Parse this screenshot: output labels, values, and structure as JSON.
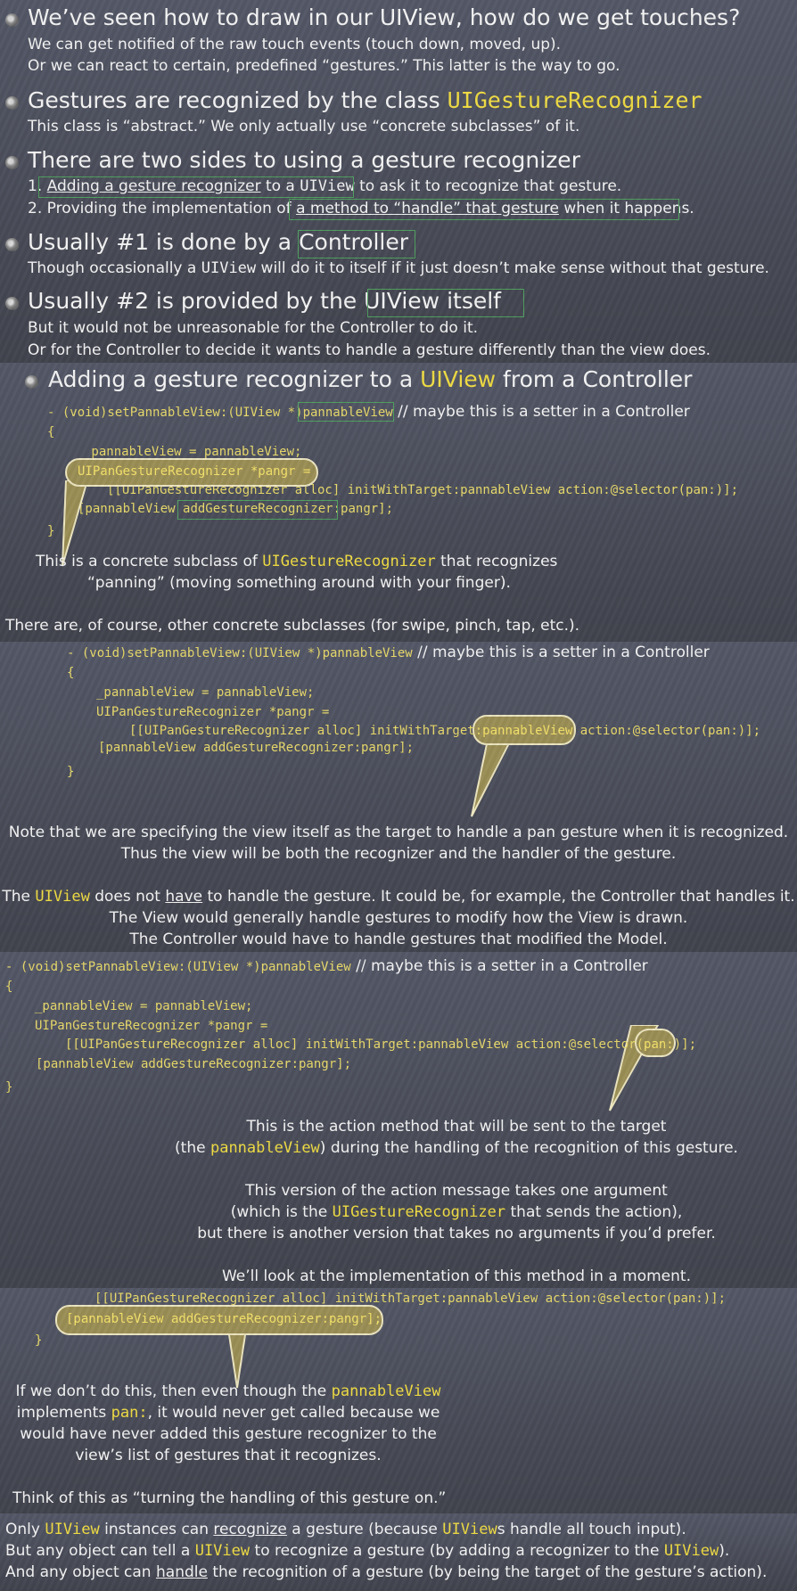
{
  "s1": {
    "b1": {
      "title": "We’ve seen how to draw in our UIView, how do we get touches?",
      "l1": "We can get notified of the raw touch events (touch down, moved, up).",
      "l2": "Or we can react to certain, predefined “gestures.”  This latter is the way to go."
    },
    "b2": {
      "t1": "Gestures are recognized by the class ",
      "t2": "UIGestureRecognizer",
      "l1": "This class is “abstract.”  We only actually use “concrete subclasses” of it."
    },
    "b3": {
      "title": "There are two sides to using a gesture recognizer",
      "l1a": "1. ",
      "l1b": "Adding a gesture recognizer",
      "l1c": " to a ",
      "l1d": "UIView",
      "l1e": " to ask it to recognize that gesture.",
      "l2a": "2. Providing the implementation of ",
      "l2b": "a method to “handle” that gesture",
      "l2c": " when it happens."
    },
    "b4": {
      "t1": "Usually #1 is done by a ",
      "t2": "Controller",
      "l1a": "Though occasionally a ",
      "l1b": "UIView",
      "l1c": " will do it to itself if it just doesn’t make sense without that gesture."
    },
    "b5": {
      "t1": "Usually #2 is provided by the ",
      "t2": "UIView itself",
      "l1": "But it would not be unreasonable for the Controller to do it.",
      "l2": "Or for the Controller to decide it wants to handle a gesture differently than the view does."
    }
  },
  "s2": {
    "t1": "Adding a gesture recognizer to a ",
    "t2": "UIView",
    "t3": " from a Controller",
    "c1a": "- (void)setPannableView:(UIView *)",
    "c1b": "pannableView",
    "c1c": " // maybe this is a setter in a Controller",
    "c2": "{",
    "c3": "_pannableView = pannableView;",
    "c4": "UIPanGestureRecognizer *pangr =",
    "c5": "[[UIPanGestureRecognizer alloc] initWithTarget:pannableView action:@selector(pan:)];",
    "c6a": "[pannableView ",
    "c6b": "addGestureRecognizer:",
    "c6c": "pangr];",
    "c7": "}",
    "n1a": "This is a concrete subclass of ",
    "n1b": "UIGestureRecognizer",
    "n1c": " that recognizes",
    "n2": "“panning” (moving something around with your finger).",
    "n3": "There are, of course, other concrete subclasses (for swipe, pinch, tap, etc.)."
  },
  "s3": {
    "c1a": "- (void)setPannableView:(UIView *)pannableView",
    "c1b": " // maybe this is a setter in a Controller",
    "c2": "{",
    "c3": "_pannableView = pannableView;",
    "c4": "UIPanGestureRecognizer *pangr =",
    "c5a": "[[UIPanGestureRecognizer alloc] initWithTarget:",
    "c5b": "pannableView",
    "c5c": " action:@selector(pan:)];",
    "c6": "[pannableView addGestureRecognizer:pangr];",
    "c7": "}",
    "n1": "Note that we are specifying the view itself as the target to handle a pan gesture when it is recognized.",
    "n2": "Thus the view will be both the recognizer and the handler of the gesture.",
    "n3a": "The ",
    "n3b": "UIView",
    "n3c": " does not ",
    "n3d": "have",
    "n3e": " to handle the gesture.  It could be, for example, the Controller that handles it.",
    "n4": "The View would generally handle gestures to modify how the View is drawn.",
    "n5": "The Controller would have to handle gestures that modified the Model."
  },
  "s4": {
    "c1a": "- (void)setPannableView:(UIView *)pannableView",
    "c1b": " // maybe this is a setter in a Controller",
    "c2": "{",
    "c3": "_pannableView = pannableView;",
    "c4": "UIPanGestureRecognizer *pangr =",
    "c5a": "[[UIPanGestureRecognizer alloc] initWithTarget:pannableView action:@selector(",
    "c5b": "pan:",
    "c5c": ")];",
    "c6": "[pannableView addGestureRecognizer:pangr];",
    "c7": "}",
    "n1": "This is the action method that will be sent to the target",
    "n2a": "(the ",
    "n2b": "pannableView",
    "n2c": ") during the handling of the recognition of this gesture.",
    "n3": "This version of the action message takes one argument",
    "n4a": "(which is the ",
    "n4b": "UIGestureRecognizer",
    "n4c": " that sends the action),",
    "n5": "but there is another version that takes no arguments if you’d prefer.",
    "n6": "We’ll look at the implementation of this method in a moment."
  },
  "s5": {
    "c1": "[[UIPanGestureRecognizer alloc] initWithTarget:pannableView action:@selector(pan:)];",
    "c2": "[pannableView addGestureRecognizer:pangr];",
    "c3": "}",
    "n1a": "If we don’t do this, then even though the ",
    "n1b": "pannableView",
    "n2a": "implements ",
    "n2b": "pan:",
    "n2c": ", it would never get called because we",
    "n3": "would have never added this gesture recognizer to the",
    "n4": "view’s list of gestures that it recognizes.",
    "n5": "Think of this as “turning the handling of this gesture on.”"
  },
  "s6": {
    "l1a": "Only ",
    "l1b": "UIView",
    "l1c": " instances can ",
    "l1d": "recognize",
    "l1e": " a gesture (because ",
    "l1f": "UIView",
    "l1g": "s handle all touch input).",
    "l2a": "But any object can tell a ",
    "l2b": "UIView",
    "l2c": " to recognize a gesture (by adding a recognizer to the ",
    "l2d": "UIView",
    "l2e": ").",
    "l3a": "And any object can ",
    "l3b": "handle",
    "l3c": " the recognition of a gesture (by being the target of the gesture’s action)."
  }
}
